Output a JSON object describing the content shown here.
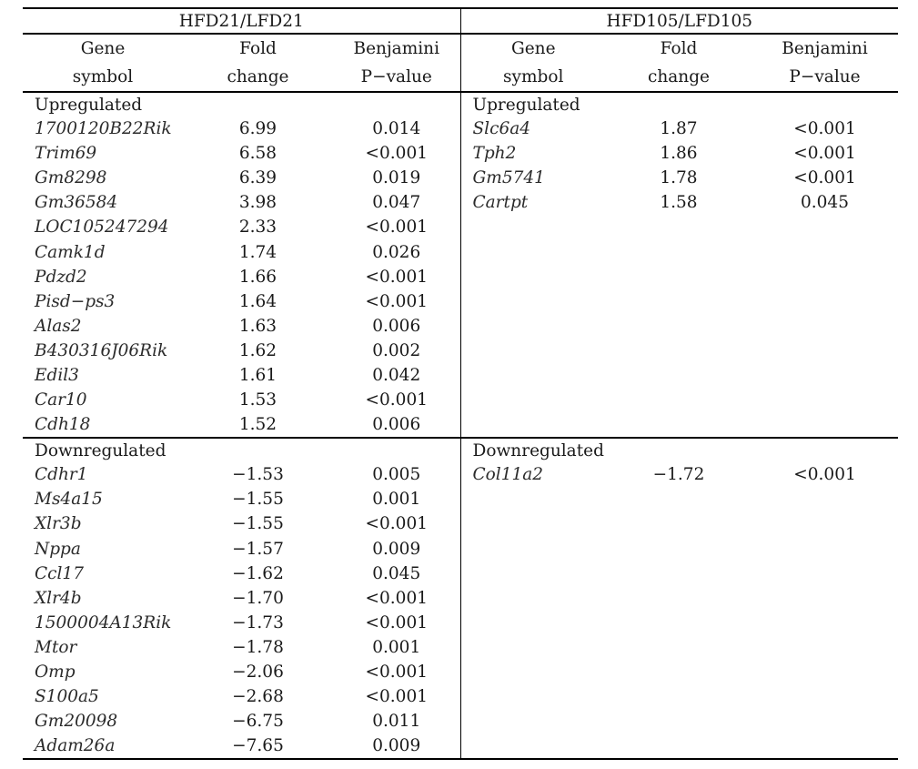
{
  "table": {
    "groups": [
      {
        "label": "HFD21/LFD21"
      },
      {
        "label": "HFD105/LFD105"
      }
    ],
    "column_headers": {
      "gene_line1": "Gene",
      "gene_line2": "symbol",
      "fold_line1": "Fold",
      "fold_line2": "change",
      "pval_line1": "Benjamini",
      "pval_line2": "P−value"
    },
    "sections": {
      "up_label": "Upregulated",
      "down_label": "Downregulated"
    },
    "hfd21": {
      "upregulated": [
        {
          "gene": "1700120B22Rik",
          "fold": "6.99",
          "p": "0.014"
        },
        {
          "gene": "Trim69",
          "fold": "6.58",
          "p": "<0.001"
        },
        {
          "gene": "Gm8298",
          "fold": "6.39",
          "p": "0.019"
        },
        {
          "gene": "Gm36584",
          "fold": "3.98",
          "p": "0.047"
        },
        {
          "gene": "LOC105247294",
          "fold": "2.33",
          "p": "<0.001"
        },
        {
          "gene": "Camk1d",
          "fold": "1.74",
          "p": "0.026"
        },
        {
          "gene": "Pdzd2",
          "fold": "1.66",
          "p": "<0.001"
        },
        {
          "gene": "Pisd−ps3",
          "fold": "1.64",
          "p": "<0.001"
        },
        {
          "gene": "Alas2",
          "fold": "1.63",
          "p": "0.006"
        },
        {
          "gene": "B430316J06Rik",
          "fold": "1.62",
          "p": "0.002"
        },
        {
          "gene": "Edil3",
          "fold": "1.61",
          "p": "0.042"
        },
        {
          "gene": "Car10",
          "fold": "1.53",
          "p": "<0.001"
        },
        {
          "gene": "Cdh18",
          "fold": "1.52",
          "p": "0.006"
        }
      ],
      "downregulated": [
        {
          "gene": "Cdhr1",
          "fold": "−1.53",
          "p": "0.005"
        },
        {
          "gene": "Ms4a15",
          "fold": "−1.55",
          "p": "0.001"
        },
        {
          "gene": "Xlr3b",
          "fold": "−1.55",
          "p": "<0.001"
        },
        {
          "gene": "Nppa",
          "fold": "−1.57",
          "p": "0.009"
        },
        {
          "gene": "Ccl17",
          "fold": "−1.62",
          "p": "0.045"
        },
        {
          "gene": "Xlr4b",
          "fold": "−1.70",
          "p": "<0.001"
        },
        {
          "gene": "1500004A13Rik",
          "fold": "−1.73",
          "p": "<0.001"
        },
        {
          "gene": "Mtor",
          "fold": "−1.78",
          "p": "0.001"
        },
        {
          "gene": "Omp",
          "fold": "−2.06",
          "p": "<0.001"
        },
        {
          "gene": "S100a5",
          "fold": "−2.68",
          "p": "<0.001"
        },
        {
          "gene": "Gm20098",
          "fold": "−6.75",
          "p": "0.011"
        },
        {
          "gene": "Adam26a",
          "fold": "−7.65",
          "p": "0.009"
        }
      ]
    },
    "hfd105": {
      "upregulated": [
        {
          "gene": "Slc6a4",
          "fold": "1.87",
          "p": "<0.001"
        },
        {
          "gene": "Tph2",
          "fold": "1.86",
          "p": "<0.001"
        },
        {
          "gene": "Gm5741",
          "fold": "1.78",
          "p": "<0.001"
        },
        {
          "gene": "Cartpt",
          "fold": "1.58",
          "p": "0.045"
        }
      ],
      "downregulated": [
        {
          "gene": "Col11a2",
          "fold": "−1.72",
          "p": "<0.001"
        }
      ]
    }
  }
}
